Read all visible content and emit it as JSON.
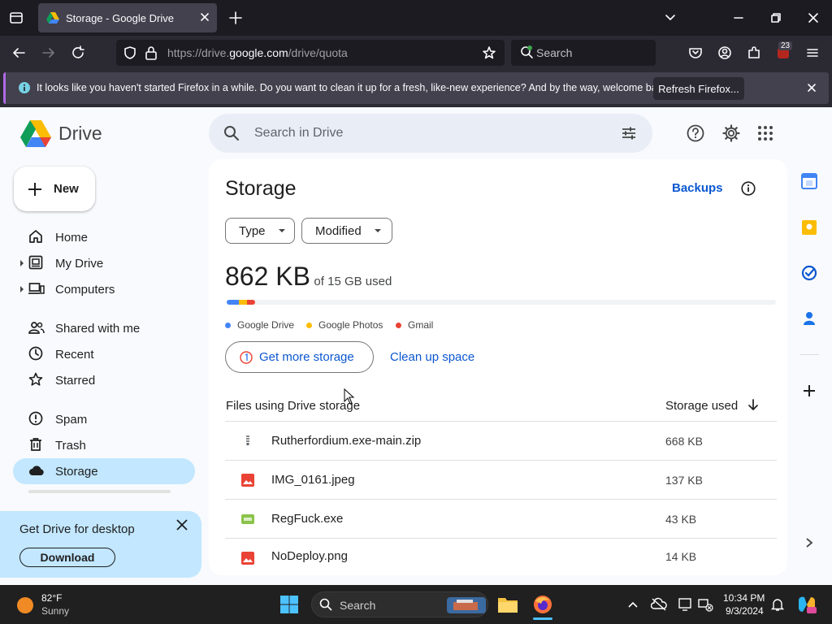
{
  "browser": {
    "tab_title": "Storage - Google Drive",
    "url_prefix": "https://drive.",
    "url_domain": "google.com",
    "url_path": "/drive/quota",
    "search_placeholder": "Search",
    "extension_badge": "23",
    "notification": {
      "message": "It looks like you haven't started Firefox in a while. Do you want to clean it up for a fresh, like-new experience? And by the way, welcome back!",
      "button": "Refresh Firefox..."
    }
  },
  "drive": {
    "logo_text": "Drive",
    "search_placeholder": "Search in Drive",
    "new_button": "New",
    "nav": {
      "home": "Home",
      "my_drive": "My Drive",
      "computers": "Computers",
      "shared": "Shared with me",
      "recent": "Recent",
      "starred": "Starred",
      "spam": "Spam",
      "trash": "Trash",
      "storage": "Storage"
    },
    "promo": {
      "title": "Get Drive for desktop",
      "button": "Download"
    },
    "main": {
      "title": "Storage",
      "backups": "Backups",
      "filters": {
        "type": "Type",
        "modified": "Modified"
      },
      "used_amount": "862 KB",
      "used_of": "of 15 GB used",
      "usage_fractions": {
        "drive": 0.022,
        "photos": 0.015,
        "gmail": 0.015
      },
      "legend": {
        "drive": "Google Drive",
        "photos": "Google Photos",
        "gmail": "Gmail"
      },
      "get_more_storage": "Get more storage",
      "clean_up_space": "Clean up space",
      "table": {
        "col_files": "Files using Drive storage",
        "col_storage": "Storage used",
        "rows": [
          {
            "name": "Rutherfordium.exe-main.zip",
            "size": "668 KB"
          },
          {
            "name": "IMG_0161.jpeg",
            "size": "137 KB"
          },
          {
            "name": "RegFuck.exe",
            "size": "43 KB"
          },
          {
            "name": "NoDeploy.png",
            "size": "14 KB"
          }
        ]
      }
    },
    "colors": {
      "drive_blue": "#4285f4",
      "photos_yellow": "#fbbc04",
      "gmail_red": "#ea4335",
      "active_nav": "#c2e7ff",
      "link": "#0b57d0"
    }
  },
  "taskbar": {
    "weather_temp": "82°F",
    "weather_desc": "Sunny",
    "search_placeholder": "Search",
    "time": "10:34 PM",
    "date": "9/3/2024"
  }
}
